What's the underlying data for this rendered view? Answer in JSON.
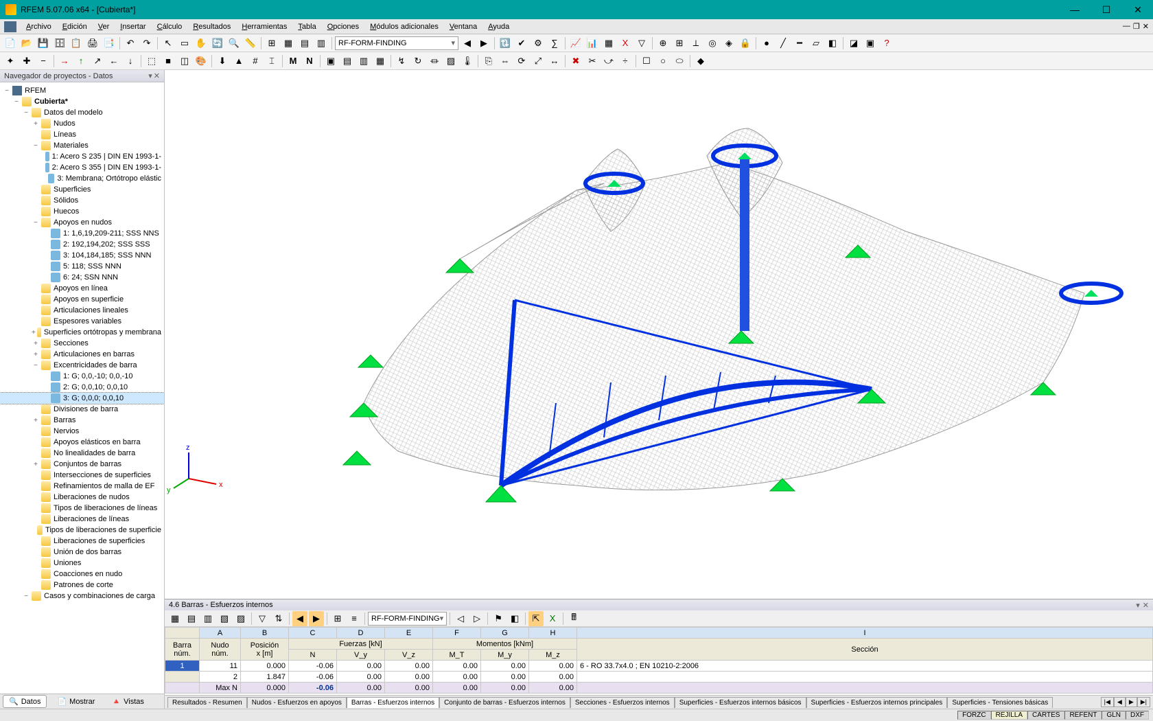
{
  "window": {
    "title": "RFEM 5.07.06 x64 - [Cubierta*]"
  },
  "minimize": "—",
  "maximize": "☐",
  "close": "✕",
  "menu": [
    {
      "label": "Archivo",
      "u": "A"
    },
    {
      "label": "Edición",
      "u": "E"
    },
    {
      "label": "Ver",
      "u": "V"
    },
    {
      "label": "Insertar",
      "u": "I"
    },
    {
      "label": "Cálculo",
      "u": "C"
    },
    {
      "label": "Resultados",
      "u": "R"
    },
    {
      "label": "Herramientas",
      "u": "H"
    },
    {
      "label": "Tabla",
      "u": "T"
    },
    {
      "label": "Opciones",
      "u": "O"
    },
    {
      "label": "Módulos adicionales",
      "u": "M"
    },
    {
      "label": "Ventana",
      "u": "V"
    },
    {
      "label": "Ayuda",
      "u": "A"
    }
  ],
  "toolbar1_combo": "RF-FORM-FINDING",
  "nav": {
    "header": "Navegador de proyectos - Datos",
    "root": "RFEM",
    "project": "Cubierta*",
    "tabs": [
      {
        "label": "Datos",
        "icon": "🔍",
        "active": true
      },
      {
        "label": "Mostrar",
        "icon": "📄"
      },
      {
        "label": "Vistas",
        "icon": "🔺"
      }
    ],
    "tree": [
      {
        "lvl": 2,
        "exp": "−",
        "icon": "folder",
        "label": "Datos del modelo"
      },
      {
        "lvl": 3,
        "exp": "+",
        "icon": "folder",
        "label": "Nudos"
      },
      {
        "lvl": 3,
        "exp": "",
        "icon": "folder",
        "label": "Líneas"
      },
      {
        "lvl": 3,
        "exp": "−",
        "icon": "folder",
        "label": "Materiales"
      },
      {
        "lvl": 4,
        "exp": "",
        "icon": "leaf",
        "label": "1: Acero S 235 | DIN EN 1993-1-"
      },
      {
        "lvl": 4,
        "exp": "",
        "icon": "leaf",
        "label": "2: Acero S 355 | DIN EN 1993-1-"
      },
      {
        "lvl": 4,
        "exp": "",
        "icon": "leaf",
        "label": "3: Membrana; Ortótropo elástic"
      },
      {
        "lvl": 3,
        "exp": "",
        "icon": "folder",
        "label": "Superficies"
      },
      {
        "lvl": 3,
        "exp": "",
        "icon": "folder",
        "label": "Sólidos"
      },
      {
        "lvl": 3,
        "exp": "",
        "icon": "folder",
        "label": "Huecos"
      },
      {
        "lvl": 3,
        "exp": "−",
        "icon": "folder",
        "label": "Apoyos en nudos"
      },
      {
        "lvl": 4,
        "exp": "",
        "icon": "leaf",
        "label": "1: 1,6,19,209-211; SSS NNS"
      },
      {
        "lvl": 4,
        "exp": "",
        "icon": "leaf",
        "label": "2: 192,194,202; SSS SSS"
      },
      {
        "lvl": 4,
        "exp": "",
        "icon": "leaf",
        "label": "3: 104,184,185; SSS NNN"
      },
      {
        "lvl": 4,
        "exp": "",
        "icon": "leaf",
        "label": "5: 118; SSS NNN"
      },
      {
        "lvl": 4,
        "exp": "",
        "icon": "leaf",
        "label": "6: 24; SSN NNN"
      },
      {
        "lvl": 3,
        "exp": "",
        "icon": "folder",
        "label": "Apoyos en línea"
      },
      {
        "lvl": 3,
        "exp": "",
        "icon": "folder",
        "label": "Apoyos en superficie"
      },
      {
        "lvl": 3,
        "exp": "",
        "icon": "folder",
        "label": "Articulaciones lineales"
      },
      {
        "lvl": 3,
        "exp": "",
        "icon": "folder",
        "label": "Espesores variables"
      },
      {
        "lvl": 3,
        "exp": "+",
        "icon": "folder",
        "label": "Superficies ortótropas y membrana"
      },
      {
        "lvl": 3,
        "exp": "+",
        "icon": "folder",
        "label": "Secciones"
      },
      {
        "lvl": 3,
        "exp": "+",
        "icon": "folder",
        "label": "Articulaciones en barras"
      },
      {
        "lvl": 3,
        "exp": "−",
        "icon": "folder",
        "label": "Excentricidades de barra"
      },
      {
        "lvl": 4,
        "exp": "",
        "icon": "leaf",
        "label": "1: G; 0,0,-10; 0,0,-10"
      },
      {
        "lvl": 4,
        "exp": "",
        "icon": "leaf",
        "label": "2: G; 0,0,10; 0,0,10"
      },
      {
        "lvl": 4,
        "exp": "",
        "icon": "leaf",
        "label": "3: G; 0,0,0; 0,0,10",
        "selected": true
      },
      {
        "lvl": 3,
        "exp": "",
        "icon": "folder",
        "label": "Divisiones de barra"
      },
      {
        "lvl": 3,
        "exp": "+",
        "icon": "folder",
        "label": "Barras"
      },
      {
        "lvl": 3,
        "exp": "",
        "icon": "folder",
        "label": "Nervios"
      },
      {
        "lvl": 3,
        "exp": "",
        "icon": "folder",
        "label": "Apoyos elásticos en barra"
      },
      {
        "lvl": 3,
        "exp": "",
        "icon": "folder",
        "label": "No linealidades de barra"
      },
      {
        "lvl": 3,
        "exp": "+",
        "icon": "folder",
        "label": "Conjuntos de barras"
      },
      {
        "lvl": 3,
        "exp": "",
        "icon": "folder",
        "label": "Intersecciones de superficies"
      },
      {
        "lvl": 3,
        "exp": "",
        "icon": "folder",
        "label": "Refinamientos de malla de EF"
      },
      {
        "lvl": 3,
        "exp": "",
        "icon": "folder",
        "label": "Liberaciones de nudos"
      },
      {
        "lvl": 3,
        "exp": "",
        "icon": "folder",
        "label": "Tipos de liberaciones de líneas"
      },
      {
        "lvl": 3,
        "exp": "",
        "icon": "folder",
        "label": "Liberaciones de líneas"
      },
      {
        "lvl": 3,
        "exp": "",
        "icon": "folder",
        "label": "Tipos de liberaciones de superficie"
      },
      {
        "lvl": 3,
        "exp": "",
        "icon": "folder",
        "label": "Liberaciones de superficies"
      },
      {
        "lvl": 3,
        "exp": "",
        "icon": "folder",
        "label": "Unión de dos barras"
      },
      {
        "lvl": 3,
        "exp": "",
        "icon": "folder",
        "label": "Uniones"
      },
      {
        "lvl": 3,
        "exp": "",
        "icon": "folder",
        "label": "Coacciones en nudo"
      },
      {
        "lvl": 3,
        "exp": "",
        "icon": "folder",
        "label": "Patrones de corte"
      },
      {
        "lvl": 2,
        "exp": "−",
        "icon": "folder",
        "label": "Casos y combinaciones de carga"
      }
    ]
  },
  "panel": {
    "title": "4.6 Barras - Esfuerzos internos",
    "combo": "RF-FORM-FINDING",
    "col_letters": [
      "A",
      "B",
      "C",
      "D",
      "E",
      "F",
      "G",
      "H",
      "I"
    ],
    "hdr1": [
      "Barra",
      "Nudo",
      "Posición",
      "Fuerzas [kN]",
      "Momentos [kNm]",
      "Sección"
    ],
    "hdr2": [
      "núm.",
      "núm.",
      "x [m]",
      "N",
      "V_y",
      "V_z",
      "M_T",
      "M_y",
      "M_z",
      ""
    ],
    "rows": [
      {
        "barra": "1",
        "nudo": "11",
        "x": "0.000",
        "n": "-0.06",
        "vy": "0.00",
        "vz": "0.00",
        "mt": "0.00",
        "my": "0.00",
        "mz": "0.00",
        "sec": "6 - RO 33.7x4.0 ; EN 10210-2:2006"
      },
      {
        "barra": "",
        "nudo": "2",
        "x": "1.847",
        "n": "-0.06",
        "vy": "0.00",
        "vz": "0.00",
        "mt": "0.00",
        "my": "0.00",
        "mz": "0.00",
        "sec": ""
      },
      {
        "barra": "",
        "nudo": "Max N",
        "x": "0.000",
        "n": "-0.06",
        "vy": "0.00",
        "vz": "0.00",
        "mt": "0.00",
        "my": "0.00",
        "mz": "0.00",
        "sec": "",
        "summary": true
      }
    ],
    "tabs": [
      "Resultados - Resumen",
      "Nudos - Esfuerzos en apoyos",
      "Barras - Esfuerzos internos",
      "Conjunto de barras - Esfuerzos internos",
      "Secciones - Esfuerzos internos",
      "Superficies - Esfuerzos internos básicos",
      "Superficies - Esfuerzos internos principales",
      "Superficies - Tensiones básicas"
    ],
    "active_tab": 2
  },
  "status": [
    "FORZC",
    "REJILLA",
    "CARTES",
    "REFENT",
    "GLN",
    "DXF"
  ],
  "axes": {
    "x": "x",
    "y": "y",
    "z": "z"
  }
}
